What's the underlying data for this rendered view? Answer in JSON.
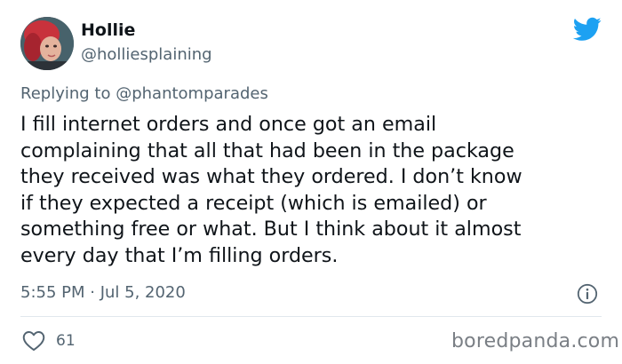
{
  "tweet": {
    "author_name": "Hollie",
    "author_handle": "@holliesplaining",
    "reply_prefix": "Replying to",
    "reply_to_handle": "@phantomparades",
    "text": "I fill internet orders and once got an email\ncomplaining that all that had been in the package\nthey received was what they ordered. I don’t know\nif they expected a receipt (which is emailed) or\nsomething free or what. But I think about it almost\nevery day that I’m filling orders.",
    "timestamp": "5:55 PM · Jul 5, 2020",
    "like_count": "61"
  },
  "icons": {
    "brand": "twitter-bird-icon",
    "info": "info-icon",
    "like": "heart-icon"
  },
  "colors": {
    "twitter_blue": "#1da1f2",
    "secondary_text": "#536471"
  },
  "watermark": "boredpanda.com"
}
